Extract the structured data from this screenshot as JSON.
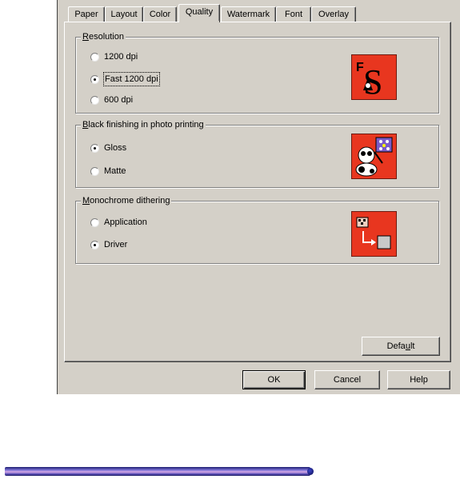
{
  "tabs": [
    "Paper",
    "Layout",
    "Color",
    "Quality",
    "Watermark",
    "Font",
    "Overlay"
  ],
  "active_tab": "Quality",
  "groups": {
    "resolution": {
      "title_accel": "R",
      "title_rest": "esolution",
      "options": [
        "1200 dpi",
        "Fast 1200 dpi",
        "600 dpi"
      ],
      "selected": "Fast 1200 dpi"
    },
    "black_finishing": {
      "title_accel": "B",
      "title_rest": "lack finishing in photo printing",
      "options": [
        "Gloss",
        "Matte"
      ],
      "selected": "Gloss"
    },
    "monochrome": {
      "title_accel": "M",
      "title_rest": "onochrome dithering",
      "options": [
        "Application",
        "Driver"
      ],
      "selected": "Driver"
    }
  },
  "icons": {
    "resolution": "fast-resolution-icon",
    "black_finishing": "photo-gloss-icon",
    "monochrome": "dithering-icon",
    "resolution_letters": {
      "f": "F",
      "s": "S"
    }
  },
  "buttons": {
    "default_pre": "Defa",
    "default_acc": "u",
    "default_post": "lt",
    "ok": "OK",
    "cancel": "Cancel",
    "help": "Help"
  },
  "colors": {
    "dialog": "#d4d0c8",
    "icon_tile": "#e8361f"
  }
}
